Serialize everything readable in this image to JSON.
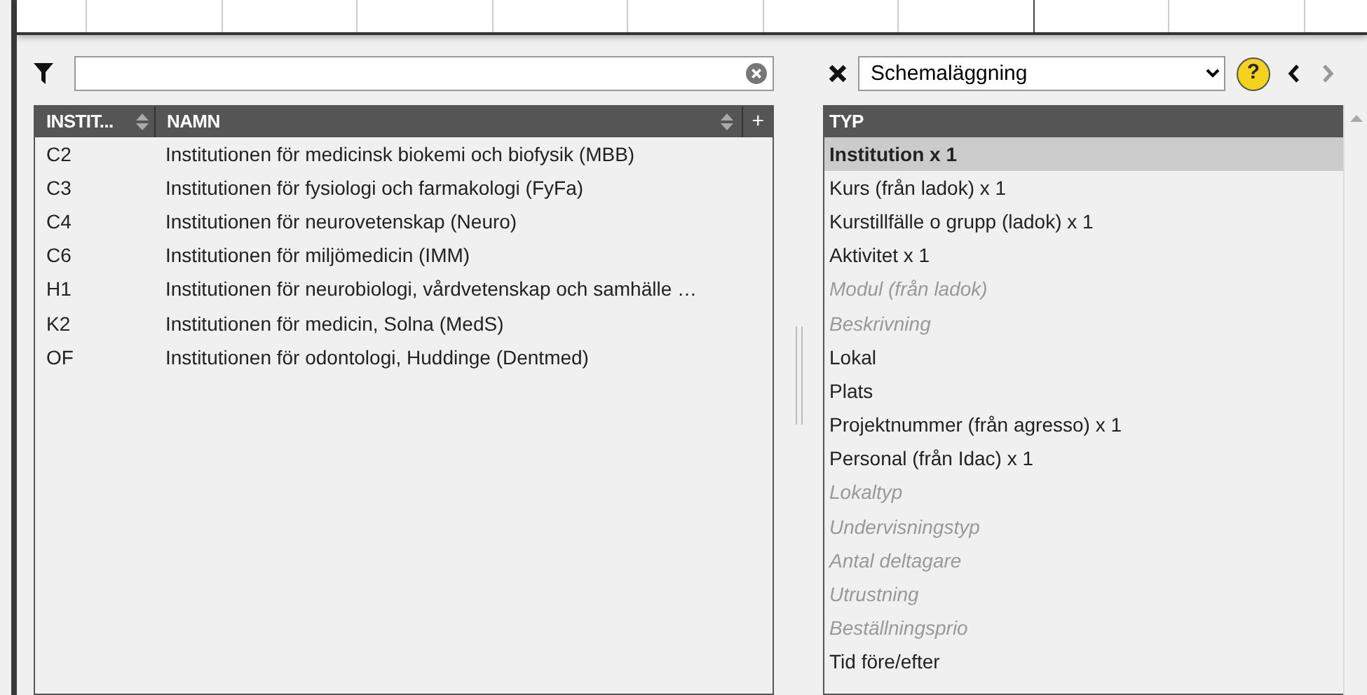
{
  "left_panel": {
    "table": {
      "columns": [
        {
          "label": "INSTIT..."
        },
        {
          "label": "NAMN"
        }
      ],
      "add_column": "+",
      "rows": [
        {
          "code": "C2",
          "name": "Institutionen för medicinsk biokemi och biofysik (MBB)"
        },
        {
          "code": "C3",
          "name": "Institutionen för fysiologi och farmakologi (FyFa)"
        },
        {
          "code": "C4",
          "name": "Institutionen för neurovetenskap (Neuro)"
        },
        {
          "code": "C6",
          "name": "Institutionen för miljömedicin (IMM)"
        },
        {
          "code": "H1",
          "name": "Institutionen för neurobiologi, vårdvetenskap och samhälle …"
        },
        {
          "code": "K2",
          "name": "Institutionen för medicin, Solna (MedS)"
        },
        {
          "code": "OF",
          "name": "Institutionen för odontologi, Huddinge (Dentmed)"
        }
      ]
    }
  },
  "right_panel": {
    "view_select": {
      "value": "Schemaläggning"
    },
    "help": "?",
    "back": {
      "disabled": false
    },
    "forward": {
      "disabled": true
    },
    "table": {
      "column": "TYP",
      "rows": [
        {
          "label": "Institution x 1",
          "selected": true,
          "disabled": false
        },
        {
          "label": "Kurs (från ladok) x 1",
          "selected": false,
          "disabled": false
        },
        {
          "label": "Kurstillfälle o grupp (ladok) x 1",
          "selected": false,
          "disabled": false
        },
        {
          "label": "Aktivitet x 1",
          "selected": false,
          "disabled": false
        },
        {
          "label": "Modul (från ladok)",
          "selected": false,
          "disabled": true
        },
        {
          "label": "Beskrivning",
          "selected": false,
          "disabled": true
        },
        {
          "label": "Lokal",
          "selected": false,
          "disabled": false
        },
        {
          "label": "Plats",
          "selected": false,
          "disabled": false
        },
        {
          "label": "Projektnummer (från agresso) x 1",
          "selected": false,
          "disabled": false
        },
        {
          "label": "Personal (från Idac) x 1",
          "selected": false,
          "disabled": false
        },
        {
          "label": "Lokaltyp",
          "selected": false,
          "disabled": true
        },
        {
          "label": "Undervisningstyp",
          "selected": false,
          "disabled": true
        },
        {
          "label": "Antal deltagare",
          "selected": false,
          "disabled": true
        },
        {
          "label": "Utrustning",
          "selected": false,
          "disabled": true
        },
        {
          "label": "Beställningsprio",
          "selected": false,
          "disabled": true
        },
        {
          "label": "Tid före/efter",
          "selected": false,
          "disabled": false
        }
      ]
    }
  }
}
